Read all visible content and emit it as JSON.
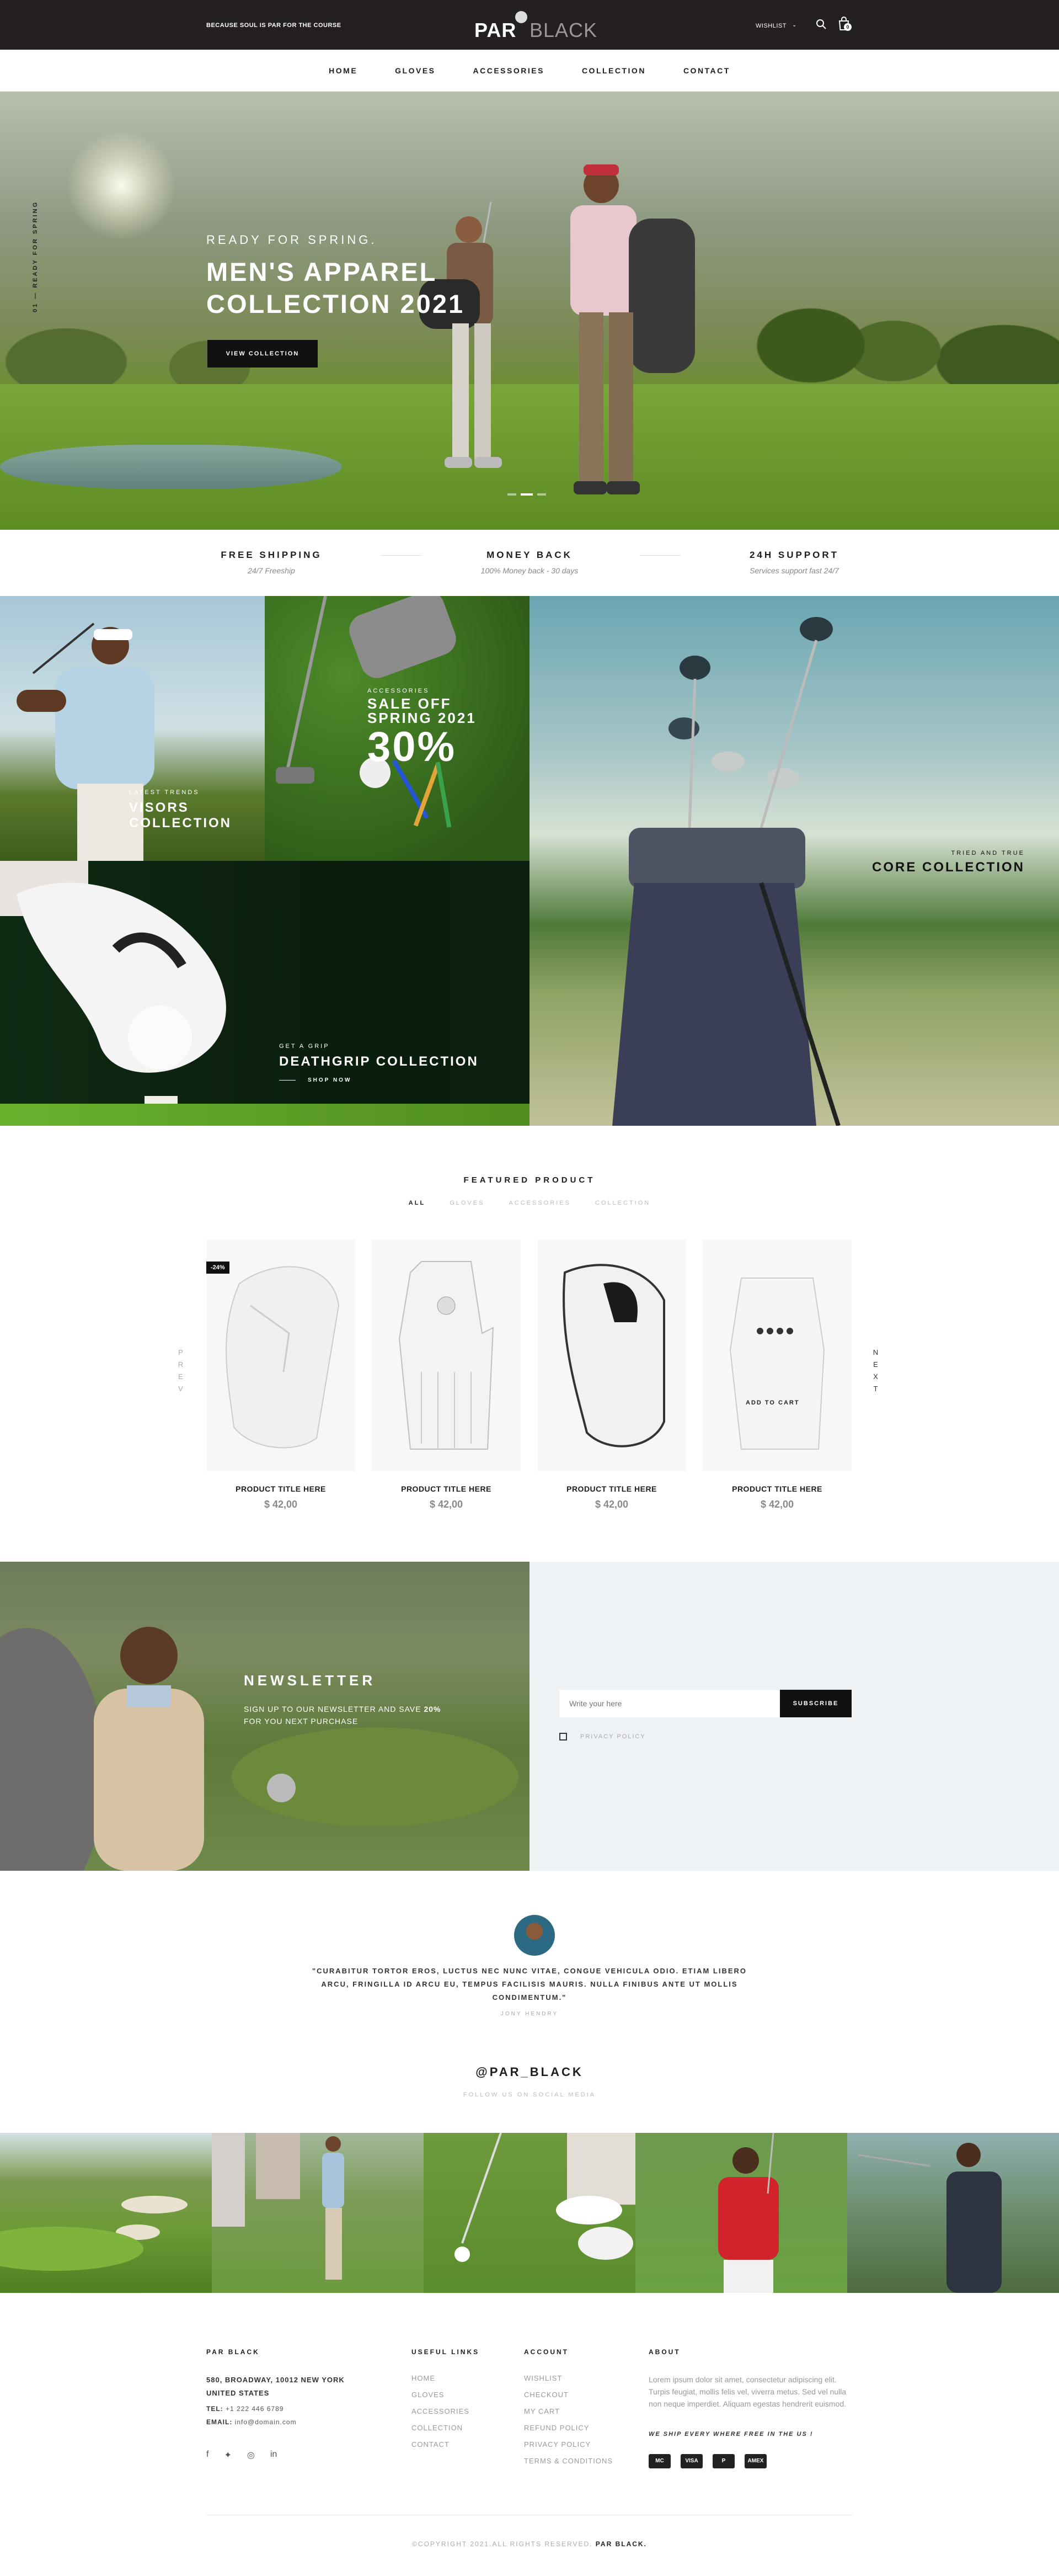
{
  "topbar": {
    "tagline": "BECAUSE SOUL IS PAR FOR THE COURSE",
    "logo_left": "PAR",
    "logo_right": "BLACK",
    "wishlist": "WISHLIST",
    "cart_count": "0"
  },
  "nav": {
    "items": [
      "HOME",
      "GLOVES",
      "ACCESSORIES",
      "COLLECTION",
      "CONTACT"
    ]
  },
  "hero": {
    "side_text": "01 — READY FOR SPRING",
    "eyebrow": "READY FOR SPRING.",
    "title_line1": "MEN'S APPAREL",
    "title_line2": "COLLECTION 2021",
    "cta": "VIEW COLLECTION"
  },
  "features": [
    {
      "title": "FREE SHIPPING",
      "subtitle": "24/7 Freeship"
    },
    {
      "title": "MONEY BACK",
      "subtitle": "100% Money back - 30 days"
    },
    {
      "title": "24H SUPPORT",
      "subtitle": "Services support fast 24/7"
    }
  ],
  "banners": {
    "visors": {
      "small": "LATEST TRENDS",
      "big1": "VISORS",
      "big2": "COLLECTION"
    },
    "sale": {
      "small": "ACCESSORIES",
      "big1": "SALE OFF",
      "big2": "SPRING 2021",
      "percent": "30%"
    },
    "deathgrip": {
      "small": "GET A GRIP",
      "big": "DEATHGRIP COLLECTION",
      "cta": "SHOP NOW"
    },
    "core": {
      "small": "TRIED AND TRUE",
      "big": "CORE COLLECTION"
    }
  },
  "featured": {
    "title": "FEATURED PRODUCT",
    "filters": [
      "ALL",
      "GLOVES",
      "ACCESSORIES",
      "COLLECTION"
    ],
    "prev": "P R E V",
    "next": "N E X T",
    "products": [
      {
        "name": "PRODUCT TITLE HERE",
        "price": "$ 42,00",
        "badge": "-24%"
      },
      {
        "name": "PRODUCT TITLE HERE",
        "price": "$ 42,00"
      },
      {
        "name": "PRODUCT TITLE HERE",
        "price": "$ 42,00"
      },
      {
        "name": "PRODUCT TITLE HERE",
        "price": "$ 42,00",
        "hover_label": "ADD TO CART"
      }
    ]
  },
  "newsletter": {
    "title": "NEWSLETTER",
    "sub_line1_prefix": "SIGN UP TO OUR NEWSLETTER AND SAVE ",
    "sub_line1_bold": "20%",
    "sub_line2": "FOR YOU NEXT PURCHASE",
    "placeholder": "Write your here",
    "button": "SUBSCRIBE",
    "privacy": "PRIVACY POLICY"
  },
  "testimonial": {
    "quote": "\"CURABITUR TORTOR EROS, LUCTUS NEC NUNC VITAE, CONGUE VEHICULA ODIO. ETIAM LIBERO ARCU, FRINGILLA ID ARCU EU, TEMPUS FACILISIS MAURIS. NULLA FINIBUS ANTE UT MOLLIS CONDIMENTUM.\"",
    "author": "JONY HENDRY"
  },
  "instagram": {
    "handle": "@PAR_BLACK",
    "sub": "FOLLOW US ON SOCIAL MEDIA"
  },
  "footer": {
    "brand_heading": "PAR BLACK",
    "address1": "580, BROADWAY, 10012 NEW YORK",
    "address2": "UNITED STATES",
    "tel_label": "TEL:",
    "tel": "+1 222 446 6789",
    "email_label": "EMAIL:",
    "email": "info@domain.com",
    "useful_heading": "USEFUL LINKS",
    "useful_links": [
      "HOME",
      "GLOVES",
      "ACCESSORIES",
      "COLLECTION",
      "CONTACT"
    ],
    "account_heading": "ACCOUNT",
    "account_links": [
      "WISHLIST",
      "CHECKOUT",
      "MY CART",
      "REFUND POLICY",
      "PRIVACY POLICY",
      "TERMS & CONDITIONS"
    ],
    "about_heading": "ABOUT",
    "about_text": "Lorem ipsum dolor sit amet, consectetur adipiscing elit. Turpis feugiat, mollis felis vel, viverra metus. Sed vel nulla non neque imperdiet. Aliquam egestas hendrerit euismod.",
    "ship_text": "WE SHIP EVERY WHERE FREE IN THE US !",
    "payments": [
      "MC",
      "VISA",
      "P",
      "AMEX"
    ],
    "copyright_prefix": "©COPYRIGHT 2021.ALL RIGHTS RESERVED.",
    "copyright_brand": "PAR BLACK."
  }
}
